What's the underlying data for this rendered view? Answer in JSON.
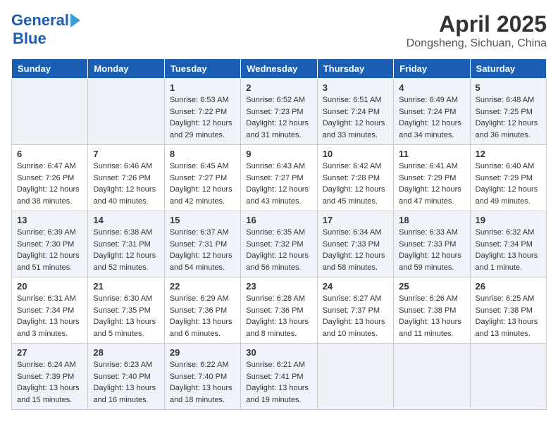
{
  "header": {
    "logo_line1": "General",
    "logo_line2": "Blue",
    "title": "April 2025",
    "subtitle": "Dongsheng, Sichuan, China"
  },
  "days_of_week": [
    "Sunday",
    "Monday",
    "Tuesday",
    "Wednesday",
    "Thursday",
    "Friday",
    "Saturday"
  ],
  "weeks": [
    [
      {
        "day": "",
        "info": ""
      },
      {
        "day": "",
        "info": ""
      },
      {
        "day": "1",
        "info": "Sunrise: 6:53 AM\nSunset: 7:22 PM\nDaylight: 12 hours and 29 minutes."
      },
      {
        "day": "2",
        "info": "Sunrise: 6:52 AM\nSunset: 7:23 PM\nDaylight: 12 hours and 31 minutes."
      },
      {
        "day": "3",
        "info": "Sunrise: 6:51 AM\nSunset: 7:24 PM\nDaylight: 12 hours and 33 minutes."
      },
      {
        "day": "4",
        "info": "Sunrise: 6:49 AM\nSunset: 7:24 PM\nDaylight: 12 hours and 34 minutes."
      },
      {
        "day": "5",
        "info": "Sunrise: 6:48 AM\nSunset: 7:25 PM\nDaylight: 12 hours and 36 minutes."
      }
    ],
    [
      {
        "day": "6",
        "info": "Sunrise: 6:47 AM\nSunset: 7:26 PM\nDaylight: 12 hours and 38 minutes."
      },
      {
        "day": "7",
        "info": "Sunrise: 6:46 AM\nSunset: 7:26 PM\nDaylight: 12 hours and 40 minutes."
      },
      {
        "day": "8",
        "info": "Sunrise: 6:45 AM\nSunset: 7:27 PM\nDaylight: 12 hours and 42 minutes."
      },
      {
        "day": "9",
        "info": "Sunrise: 6:43 AM\nSunset: 7:27 PM\nDaylight: 12 hours and 43 minutes."
      },
      {
        "day": "10",
        "info": "Sunrise: 6:42 AM\nSunset: 7:28 PM\nDaylight: 12 hours and 45 minutes."
      },
      {
        "day": "11",
        "info": "Sunrise: 6:41 AM\nSunset: 7:29 PM\nDaylight: 12 hours and 47 minutes."
      },
      {
        "day": "12",
        "info": "Sunrise: 6:40 AM\nSunset: 7:29 PM\nDaylight: 12 hours and 49 minutes."
      }
    ],
    [
      {
        "day": "13",
        "info": "Sunrise: 6:39 AM\nSunset: 7:30 PM\nDaylight: 12 hours and 51 minutes."
      },
      {
        "day": "14",
        "info": "Sunrise: 6:38 AM\nSunset: 7:31 PM\nDaylight: 12 hours and 52 minutes."
      },
      {
        "day": "15",
        "info": "Sunrise: 6:37 AM\nSunset: 7:31 PM\nDaylight: 12 hours and 54 minutes."
      },
      {
        "day": "16",
        "info": "Sunrise: 6:35 AM\nSunset: 7:32 PM\nDaylight: 12 hours and 56 minutes."
      },
      {
        "day": "17",
        "info": "Sunrise: 6:34 AM\nSunset: 7:33 PM\nDaylight: 12 hours and 58 minutes."
      },
      {
        "day": "18",
        "info": "Sunrise: 6:33 AM\nSunset: 7:33 PM\nDaylight: 12 hours and 59 minutes."
      },
      {
        "day": "19",
        "info": "Sunrise: 6:32 AM\nSunset: 7:34 PM\nDaylight: 13 hours and 1 minute."
      }
    ],
    [
      {
        "day": "20",
        "info": "Sunrise: 6:31 AM\nSunset: 7:34 PM\nDaylight: 13 hours and 3 minutes."
      },
      {
        "day": "21",
        "info": "Sunrise: 6:30 AM\nSunset: 7:35 PM\nDaylight: 13 hours and 5 minutes."
      },
      {
        "day": "22",
        "info": "Sunrise: 6:29 AM\nSunset: 7:36 PM\nDaylight: 13 hours and 6 minutes."
      },
      {
        "day": "23",
        "info": "Sunrise: 6:28 AM\nSunset: 7:36 PM\nDaylight: 13 hours and 8 minutes."
      },
      {
        "day": "24",
        "info": "Sunrise: 6:27 AM\nSunset: 7:37 PM\nDaylight: 13 hours and 10 minutes."
      },
      {
        "day": "25",
        "info": "Sunrise: 6:26 AM\nSunset: 7:38 PM\nDaylight: 13 hours and 11 minutes."
      },
      {
        "day": "26",
        "info": "Sunrise: 6:25 AM\nSunset: 7:38 PM\nDaylight: 13 hours and 13 minutes."
      }
    ],
    [
      {
        "day": "27",
        "info": "Sunrise: 6:24 AM\nSunset: 7:39 PM\nDaylight: 13 hours and 15 minutes."
      },
      {
        "day": "28",
        "info": "Sunrise: 6:23 AM\nSunset: 7:40 PM\nDaylight: 13 hours and 16 minutes."
      },
      {
        "day": "29",
        "info": "Sunrise: 6:22 AM\nSunset: 7:40 PM\nDaylight: 13 hours and 18 minutes."
      },
      {
        "day": "30",
        "info": "Sunrise: 6:21 AM\nSunset: 7:41 PM\nDaylight: 13 hours and 19 minutes."
      },
      {
        "day": "",
        "info": ""
      },
      {
        "day": "",
        "info": ""
      },
      {
        "day": "",
        "info": ""
      }
    ]
  ]
}
